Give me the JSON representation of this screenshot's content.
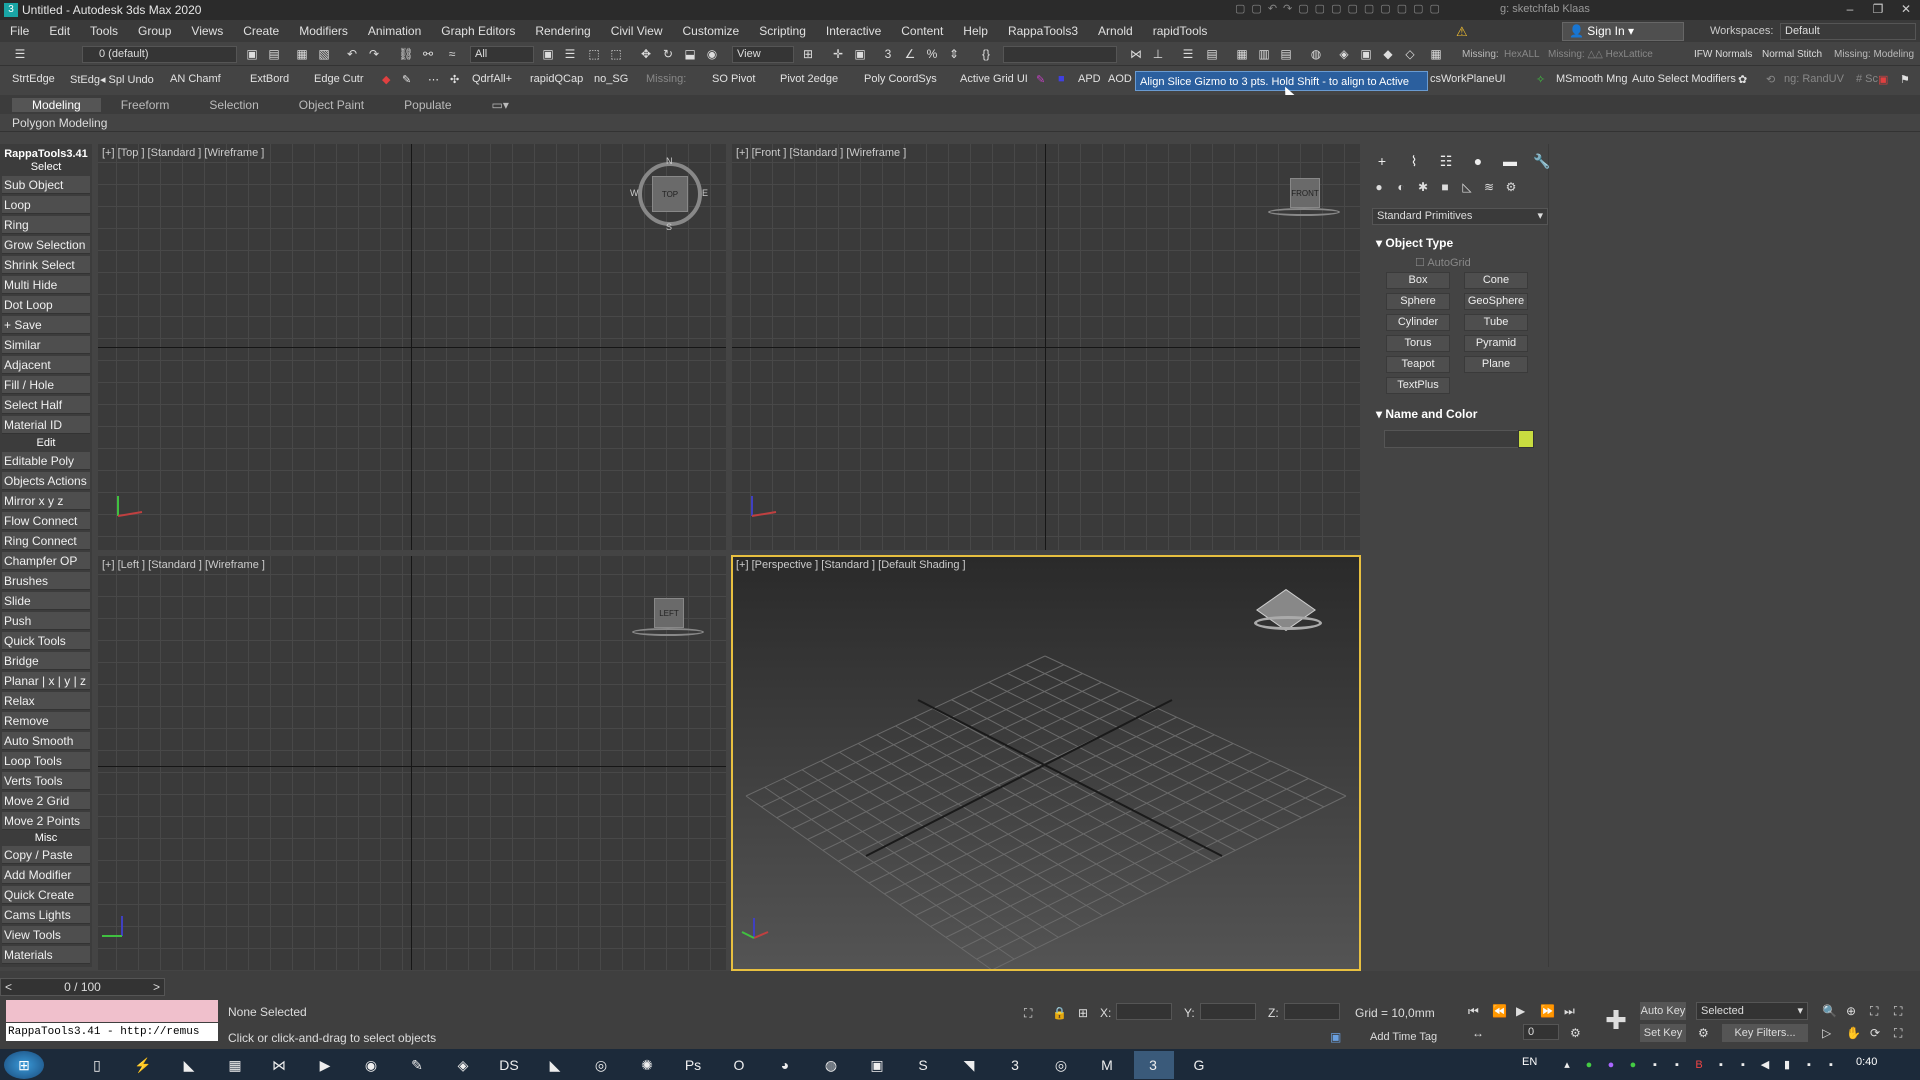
{
  "window": {
    "title": "Untitled - Autodesk 3ds Max 2020",
    "search_hint": "g: sketchfab Klaas",
    "min": "–",
    "max": "❐",
    "close": "✕"
  },
  "menu": [
    "File",
    "Edit",
    "Tools",
    "Group",
    "Views",
    "Create",
    "Modifiers",
    "Animation",
    "Graph Editors",
    "Rendering",
    "Civil View",
    "Customize",
    "Scripting",
    "Interactive",
    "Content",
    "Help",
    "RappaTools3",
    "Arnold",
    "rapidTools"
  ],
  "account": {
    "sign_in": "Sign In",
    "workspaces_label": "Workspaces:",
    "workspace": "Default"
  },
  "toolbar1": {
    "layer": "0 (default)",
    "selection_filter": "All",
    "ref_coord": "View",
    "missing1": "Missing:",
    "hexall": "HexALL",
    "missing2": "Missing: △△ HexLattice",
    "ifw": "IFW Normals",
    "normal_stitch": "Normal Stitch",
    "missing3": "Missing: Modeling"
  },
  "toolbar2": {
    "items": [
      "StrtEdge",
      "StEdg◂ Spl Undo",
      "AN Chamf",
      "ExtBord",
      "Edge Cutr",
      "QdrfAll+",
      "rapidQCap",
      "no_SG",
      "Missing:",
      "SO Pivot",
      "Pivot 2edge",
      "Poly CoordSys",
      "Active Grid UI",
      "APD",
      "AOD",
      "csWorkPlaneUI",
      "MSmooth Mng",
      "Auto Select Modifiers",
      "ng: RandUV",
      "# Sc"
    ],
    "tooltip": "Align Slice Gizmo to 3 pts. Hold Shift - to align to Active Grid"
  },
  "ribbon": {
    "tabs": [
      "Modeling",
      "Freeform",
      "Selection",
      "Object Paint",
      "Populate"
    ],
    "sub_label": "Polygon Modeling"
  },
  "left_panel": {
    "header": "RappaTools3.41",
    "sections": {
      "select": "Select",
      "edit": "Edit",
      "misc": "Misc"
    },
    "select_items": [
      "Sub Object",
      "Loop",
      "Ring",
      "Grow Selection",
      "Shrink Select",
      "Multi Hide",
      "Dot Loop",
      "+ Save",
      "Similar",
      "Adjacent",
      "Fill / Hole",
      "Select Half",
      "Material ID"
    ],
    "edit_items": [
      "Editable Poly",
      "Objects Actions",
      "Mirror   x  y  z",
      "Flow Connect",
      "Ring Connect",
      "Champfer OP",
      "Brushes",
      "Slide",
      "Push",
      "Quick Tools",
      "Bridge",
      "Planar | x | y | z",
      "Relax",
      "Remove",
      "Auto Smooth",
      "Loop Tools",
      "Verts Tools",
      "Move 2 Grid",
      "Move 2 Points"
    ],
    "misc_items": [
      "Copy / Paste",
      "Add Modifier",
      "Quick Create",
      "Cams Lights",
      "View Tools",
      "Materials"
    ]
  },
  "viewports": {
    "top": "[+] [Top ] [Standard ] [Wireframe ]",
    "front": "[+] [Front ] [Standard ] [Wireframe ]",
    "left": "[+] [Left ] [Standard ] [Wireframe ]",
    "perspective": "[+] [Perspective ] [Standard ] [Default Shading ]",
    "cube_top": "TOP",
    "cube_front": "FRONT",
    "cube_left": "LEFT",
    "compass": {
      "n": "N",
      "s": "S",
      "e": "E",
      "w": "W"
    }
  },
  "command_panel": {
    "category": "Standard Primitives",
    "object_type_title": "Object Type",
    "autogrid": "AutoGrid",
    "buttons": [
      "Box",
      "Cone",
      "Sphere",
      "GeoSphere",
      "Cylinder",
      "Tube",
      "Torus",
      "Pyramid",
      "Teapot",
      "Plane",
      "TextPlus"
    ],
    "name_color_title": "Name and Color",
    "swatch_color": "#c8dc40"
  },
  "status": {
    "frame": "0 / 100",
    "maxscript": "RappaTools3.41 - http://remus",
    "selection": "None Selected",
    "prompt": "Click or click-and-drag to select objects",
    "x_label": "X:",
    "y_label": "Y:",
    "z_label": "Z:",
    "grid": "Grid = 10,0mm",
    "add_time_tag": "Add Time Tag",
    "auto_key": "Auto Key",
    "selected": "Selected",
    "set_key": "Set Key",
    "key_filters": "Key Filters...",
    "current_frame": "0"
  },
  "taskbar": {
    "lang": "EN",
    "time": "0:40"
  }
}
